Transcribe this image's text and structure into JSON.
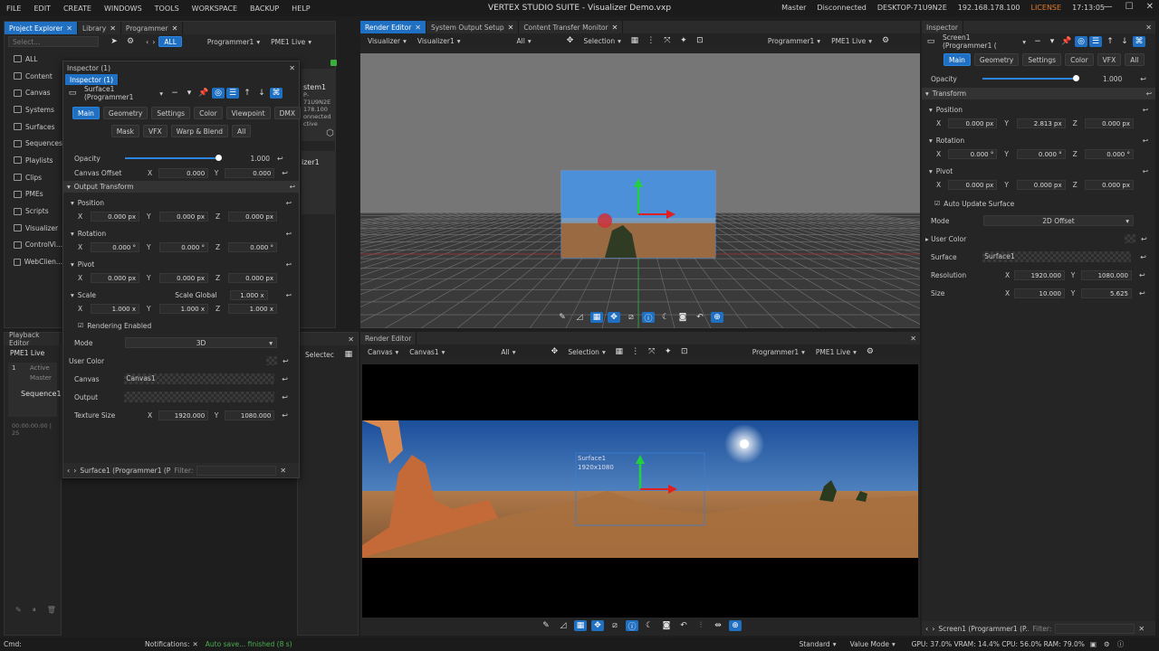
{
  "menu": [
    "FILE",
    "EDIT",
    "CREATE",
    "WINDOWS",
    "TOOLS",
    "WORKSPACE",
    "BACKUP",
    "HELP"
  ],
  "app_title": "VERTEX STUDIO SUITE - Visualizer Demo.vxp",
  "status": {
    "master": "Master",
    "connection": "Disconnected",
    "machine": "DESKTOP-71U9N2E",
    "ip": "192.168.178.100",
    "license": "LICENSE",
    "time": "17:13:05"
  },
  "left_tabs": [
    "Project Explorer",
    "Library",
    "Programmer"
  ],
  "search_placeholder": "Select...",
  "all_label": "ALL",
  "programmer_dd": "Programmer1",
  "pme_dd": "PME1 Live",
  "tree": [
    "ALL",
    "Content",
    "Canvas",
    "Systems",
    "Surfaces",
    "Sequences",
    "Playlists",
    "Clips",
    "PMEs",
    "Scripts",
    "Visualizer",
    "ControlVi...",
    "WebClien..."
  ],
  "system_card": {
    "name": "stem1",
    "machine": "P-71U9N2E",
    "ip": "178.100",
    "state": "onnected",
    "active": "ctive"
  },
  "visualizer_card": "izer1",
  "playback": {
    "title": "Playback Editor",
    "pme": "PME1 Live",
    "idx": "1",
    "active": "Active",
    "master": "Master",
    "sequence": "Sequence1",
    "time": "00:00:00:00 | 25"
  },
  "inspector_float": {
    "title": "Inspector (1)",
    "tab": "Inspector (1)",
    "target": "Surface1 (Programmer1",
    "tabs_row1": [
      "Main",
      "Geometry",
      "Settings",
      "Color",
      "Viewpoint",
      "DMX"
    ],
    "tabs_row2": [
      "Mask",
      "VFX",
      "Warp & Blend",
      "All"
    ],
    "opacity_label": "Opacity",
    "opacity_value": "1.000",
    "opacity_level": 1.0,
    "canvas_offset_label": "Canvas Offset",
    "canvas_offset_x": "0.000",
    "canvas_offset_y": "0.000",
    "output_transform": "Output Transform",
    "position": "Position",
    "rotation": "Rotation",
    "pivot": "Pivot",
    "scale": "Scale",
    "scale_global": "Scale Global",
    "scale_global_val": "1.000 x",
    "pos": [
      "0.000 px",
      "0.000 px",
      "0.000 px"
    ],
    "rot": [
      "0.000 °",
      "0.000 °",
      "0.000 °"
    ],
    "piv": [
      "0.000 px",
      "0.000 px",
      "0.000 px"
    ],
    "scl": [
      "1.000 x",
      "1.000 x",
      "1.000 x"
    ],
    "rendering_enabled": "Rendering Enabled",
    "mode_label": "Mode",
    "mode_value": "3D",
    "user_color": "User Color",
    "canvas_label": "Canvas",
    "canvas_value": "Canvas1",
    "output_label": "Output",
    "texture_label": "Texture Size",
    "texture_x": "1920.000",
    "texture_y": "1080.000",
    "footer_target": "Surface1 (Programmer1 (P...",
    "filter_label": "Filter:"
  },
  "center_tabs": [
    "Render Editor",
    "System Output Setup",
    "Content Transfer Monitor"
  ],
  "top_view": {
    "dd1": "Visualizer",
    "dd2": "Visualizer1",
    "all": "All",
    "selection": "Selection",
    "programmer": "Programmer1",
    "pme": "PME1 Live"
  },
  "bottom_view": {
    "tab": "Render Editor",
    "dd1": "Canvas",
    "dd2": "Canvas1",
    "all": "All",
    "selection": "Selection",
    "programmer": "Programmer1",
    "pme": "PME1 Live",
    "surface_label": "Surface1",
    "surface_res": "1920x1080"
  },
  "mid_left": {
    "select": "Selectec"
  },
  "inspector_right": {
    "title": "Inspector",
    "target": "Screen1 (Programmer1 (",
    "tabs": [
      "Main",
      "Geometry",
      "Settings",
      "Color",
      "VFX",
      "All"
    ],
    "opacity_label": "Opacity",
    "opacity_value": "1.000",
    "opacity_level": 1.0,
    "transform": "Transform",
    "position": "Position",
    "rotation": "Rotation",
    "pivot": "Pivot",
    "pos": [
      "0.000 px",
      "2.813 px",
      "0.000 px"
    ],
    "rot": [
      "0.000 °",
      "0.000 °",
      "0.000 °"
    ],
    "piv": [
      "0.000 px",
      "0.000 px",
      "0.000 px"
    ],
    "auto_update": "Auto Update Surface",
    "mode_label": "Mode",
    "mode_value": "2D Offset",
    "user_color": "User Color",
    "surface_label": "Surface",
    "surface_value": "Surface1",
    "resolution_label": "Resolution",
    "res_x": "1920.000",
    "res_y": "1080.000",
    "size_label": "Size",
    "size_x": "10.000",
    "size_y": "5.625",
    "footer_target": "Screen1 (Programmer1 (P...",
    "filter_label": "Filter:"
  },
  "bottom": {
    "cmd": "Cmd:",
    "notifications": "Notifications:",
    "autosave": "Auto save... finished (8 s)",
    "standard": "Standard",
    "value_mode": "Value Mode",
    "perf": "GPU: 37.0% VRAM: 14.4% CPU: 56.0% RAM: 79.0%"
  },
  "axis_labels": {
    "x": "X",
    "y": "Y",
    "z": "Z"
  },
  "colors": {
    "accent": "#1f6fc2",
    "license": "#e0792c",
    "gizmo_x": "#e02020",
    "gizmo_y": "#20d040",
    "autosave": "#4caf50"
  }
}
